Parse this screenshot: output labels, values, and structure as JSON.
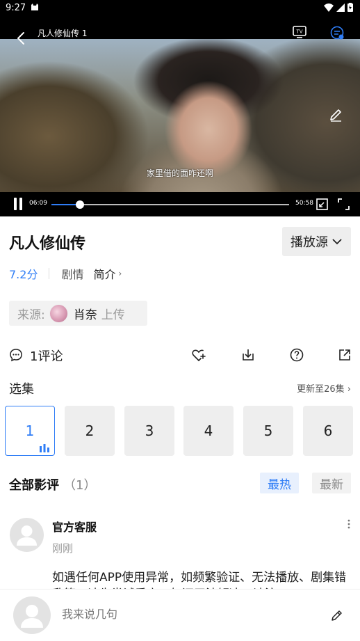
{
  "status_bar": {
    "time": "9:27"
  },
  "player": {
    "title": "凡人修仙传 1",
    "subtitle": "家里借的面咋还啊",
    "current_time": "06:09",
    "total_time": "50:58",
    "progress": 0.12
  },
  "info": {
    "title": "凡人修仙传",
    "source_button": "播放源",
    "score": "7.2分",
    "genre": "剧情",
    "intro": "简介"
  },
  "uploader": {
    "label": "来源:",
    "name": "肖奈",
    "action": "上传"
  },
  "actions": {
    "comment_count": "1评论"
  },
  "episodes": {
    "label": "选集",
    "update": "更新至26集",
    "items": [
      "1",
      "2",
      "3",
      "4",
      "5",
      "6"
    ],
    "active": "1"
  },
  "reviews": {
    "title": "全部影评",
    "count": "（1）",
    "sort_hot": "最热",
    "sort_new": "最新",
    "items": [
      {
        "name": "官方客服",
        "time": "刚刚",
        "text": "如遇任何APP使用异常，如频繁验证、无法播放、剧集错乱等，请先尝试重启，如还无法解决，请注"
      }
    ]
  },
  "bottom": {
    "placeholder": "我来说几句"
  },
  "colors": {
    "accent": "#2f7df6"
  },
  "icons": [
    "back-icon",
    "tv-cast-icon",
    "danmu-icon",
    "pencil-icon",
    "pause-icon",
    "mini-window-icon",
    "fullscreen-icon",
    "chevron-down-icon",
    "comment-icon",
    "favorite-icon",
    "download-icon",
    "help-icon",
    "share-icon",
    "more-icon",
    "edit-icon"
  ]
}
